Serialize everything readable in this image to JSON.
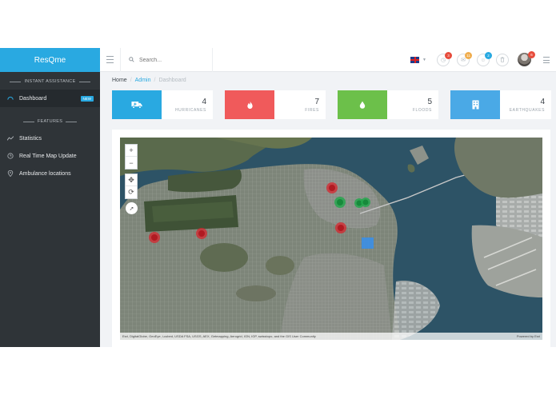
{
  "app": {
    "brand": "ResQme"
  },
  "sidebar": {
    "section_assistance": "INSTANT ASSISTANCE",
    "section_features": "FEATURES",
    "items": [
      {
        "label": "Dashboard",
        "badge": "NEW",
        "icon": "dashboard-icon"
      },
      {
        "label": "Statistics",
        "icon": "chart-icon"
      },
      {
        "label": "Real Time Map Update",
        "icon": "clock-icon"
      },
      {
        "label": "Ambulance locations",
        "icon": "location-pin-icon"
      }
    ]
  },
  "header": {
    "search_placeholder": "Search...",
    "counts": {
      "a": "3",
      "b": "11",
      "c": "2",
      "avatar": "6"
    }
  },
  "breadcrumb": {
    "home": "Home",
    "sep": "/",
    "admin": "Admin",
    "current": "Dashboard"
  },
  "stats": [
    {
      "value": "4",
      "label": "HURRICANES",
      "color": "#29a9e1",
      "icon": "ambulance-icon"
    },
    {
      "value": "7",
      "label": "FIRES",
      "color": "#f05a5b",
      "icon": "fire-icon"
    },
    {
      "value": "5",
      "label": "FLOODS",
      "color": "#6cc04a",
      "icon": "water-drop-icon"
    },
    {
      "value": "4",
      "label": "EARTHQUAKES",
      "color": "#4aa9e6",
      "icon": "building-icon"
    }
  ],
  "map": {
    "attribution": "Esri, DigitalGlobe, GeoEye, i-cubed, USDA FSA, USGS, AEX, Getmapping, Aerogrid, IGN, IGP, swisstopo, and the GIS User Community",
    "powered": "Powered by Esri",
    "zoom_in": "+",
    "zoom_out": "−"
  }
}
